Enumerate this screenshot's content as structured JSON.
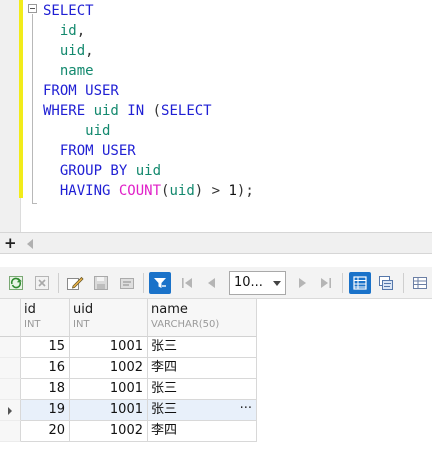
{
  "editor": {
    "lines": [
      [
        {
          "t": "SELECT",
          "c": "kw"
        }
      ],
      [
        {
          "t": "  "
        },
        {
          "t": "id",
          "c": "id"
        },
        {
          "t": ",",
          "c": "op"
        }
      ],
      [
        {
          "t": "  "
        },
        {
          "t": "uid",
          "c": "id"
        },
        {
          "t": ",",
          "c": "op"
        }
      ],
      [
        {
          "t": "  "
        },
        {
          "t": "name",
          "c": "id"
        }
      ],
      [
        {
          "t": "FROM USER",
          "c": "kw"
        }
      ],
      [
        {
          "t": "WHERE ",
          "c": "kw"
        },
        {
          "t": "uid",
          "c": "id"
        },
        {
          "t": " IN ",
          "c": "kw"
        },
        {
          "t": "(",
          "c": "op"
        },
        {
          "t": "SELECT",
          "c": "kw"
        }
      ],
      [
        {
          "t": "     "
        },
        {
          "t": "uid",
          "c": "id"
        }
      ],
      [
        {
          "t": "  "
        },
        {
          "t": "FROM USER",
          "c": "kw"
        }
      ],
      [
        {
          "t": "  "
        },
        {
          "t": "GROUP BY ",
          "c": "kw"
        },
        {
          "t": "uid",
          "c": "id"
        }
      ],
      [
        {
          "t": "  "
        },
        {
          "t": "HAVING ",
          "c": "kw"
        },
        {
          "t": "COUNT",
          "c": "fn"
        },
        {
          "t": "(",
          "c": "op"
        },
        {
          "t": "uid",
          "c": "id"
        },
        {
          "t": ") > ",
          "c": "op"
        },
        {
          "t": "1",
          "c": "num"
        },
        {
          "t": ");",
          "c": "op"
        }
      ]
    ]
  },
  "toolbar": {
    "page_size_value": "10..."
  },
  "grid": {
    "columns": [
      {
        "name": "id",
        "type": "INT"
      },
      {
        "name": "uid",
        "type": "INT"
      },
      {
        "name": "name",
        "type": "VARCHAR(50)"
      }
    ],
    "rows": [
      {
        "id": "15",
        "uid": "1001",
        "name": "张三"
      },
      {
        "id": "16",
        "uid": "1002",
        "name": "李四"
      },
      {
        "id": "18",
        "uid": "1001",
        "name": "张三"
      },
      {
        "id": "19",
        "uid": "1001",
        "name": "张三"
      },
      {
        "id": "20",
        "uid": "1002",
        "name": "李四"
      }
    ],
    "selected_row_index": 3,
    "ellipsis": "···"
  },
  "colors": {
    "keyword": "#1f1fd4",
    "identifier": "#13896e",
    "function": "#e020c8",
    "change_bar": "#f2ec1a",
    "toolbar_active": "#1a72c9"
  }
}
